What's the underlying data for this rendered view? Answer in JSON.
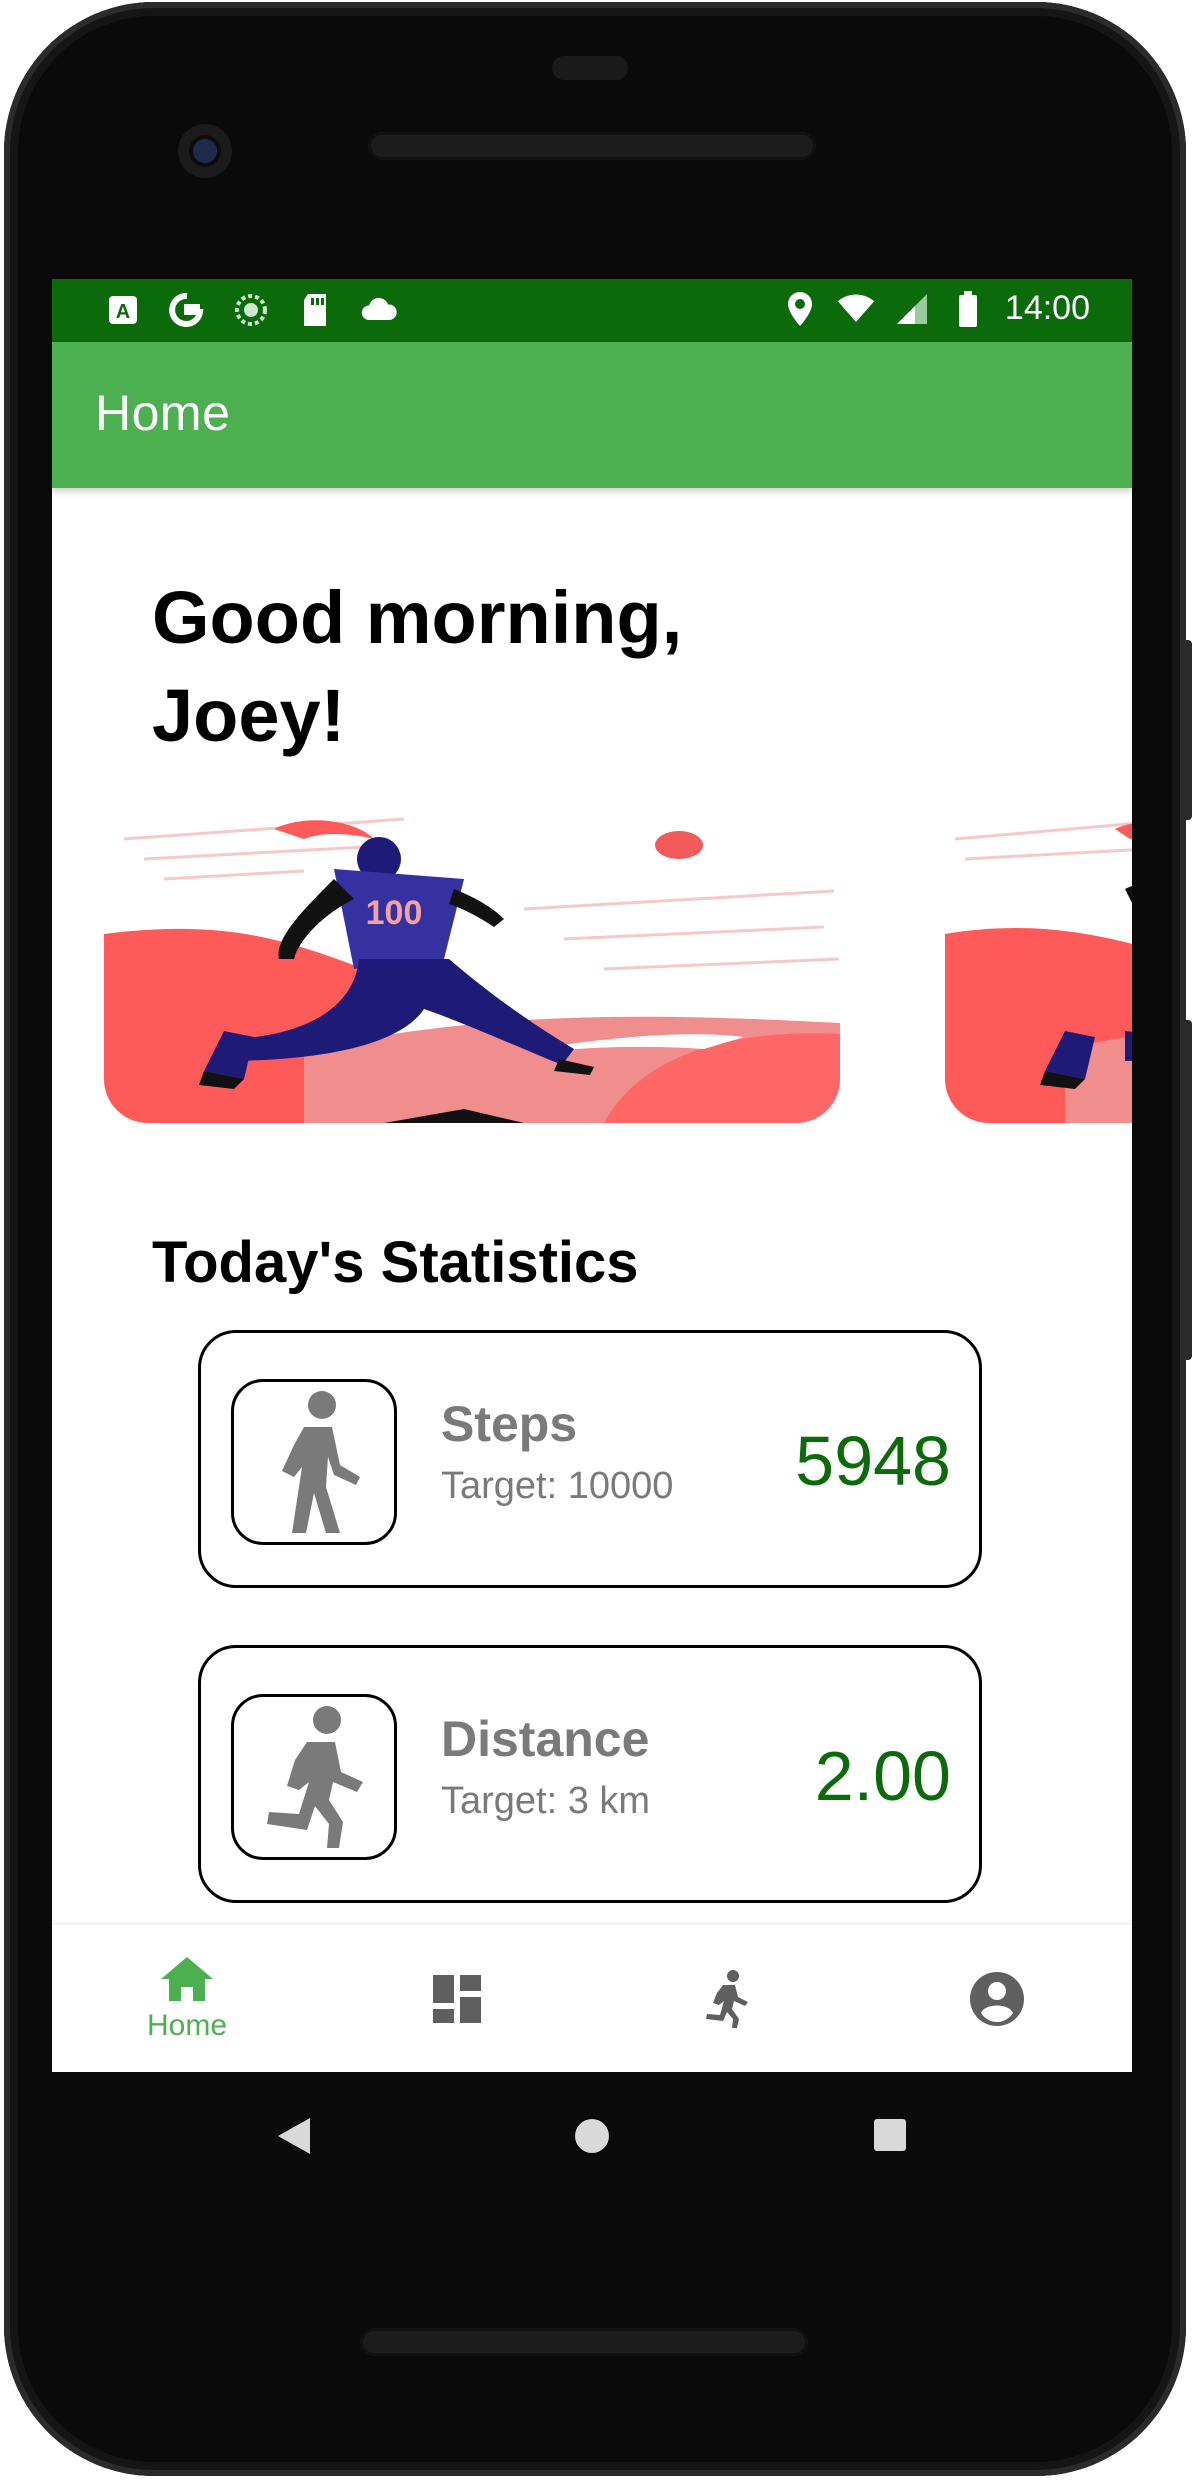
{
  "status_bar": {
    "time": "14:00",
    "left_icons": [
      "a-icon",
      "google-icon",
      "sync-icon",
      "sd-card-icon",
      "cloud-icon"
    ],
    "right_icons": [
      "location-icon",
      "wifi-icon",
      "signal-icon",
      "battery-icon"
    ]
  },
  "app_bar": {
    "title": "Home"
  },
  "greeting": "Good morning,\n Joey!",
  "banner": {
    "jersey_number": "100"
  },
  "stats": {
    "title": "Today's Statistics",
    "cards": [
      {
        "label": "Steps",
        "target": "Target: 10000",
        "value": "5948",
        "icon": "walk-icon"
      },
      {
        "label": "Distance",
        "target": "Target: 3 km",
        "value": "2.00",
        "icon": "run-icon"
      }
    ]
  },
  "bottom_nav": {
    "items": [
      {
        "label": "Home",
        "icon": "home-icon",
        "active": true
      },
      {
        "label": "",
        "icon": "dashboard-icon",
        "active": false
      },
      {
        "label": "",
        "icon": "run-icon",
        "active": false
      },
      {
        "label": "",
        "icon": "account-icon",
        "active": false
      }
    ]
  },
  "colors": {
    "status_bar": "#0b6b0b",
    "app_bar": "#4caf50",
    "accent_value": "#0b6b0b",
    "nav_active": "#4caf50",
    "nav_inactive": "#5f5f5f",
    "banner_red": "#ff5a5a",
    "banner_navy": "#1e1a78"
  },
  "android_nav": {
    "buttons": [
      "back-button",
      "home-button",
      "recents-button"
    ]
  }
}
